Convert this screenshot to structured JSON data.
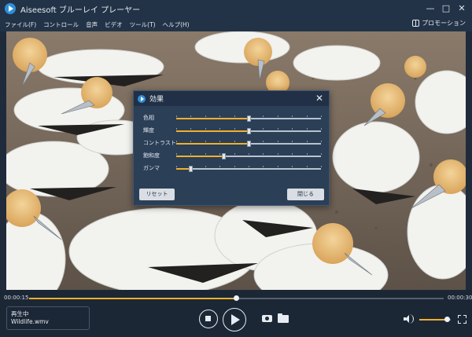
{
  "app": {
    "title": "Aiseesoft ブルーレイ プレーヤー"
  },
  "window_controls": {
    "minimize": "—",
    "maximize": "□",
    "close": "✕"
  },
  "menu": {
    "items": [
      "ファイル(F)",
      "コントロール",
      "音声",
      "ビデオ",
      "ツール(T)",
      "ヘルプ(H)"
    ]
  },
  "promo": {
    "label": "プロモーション"
  },
  "effects_dialog": {
    "title": "効果",
    "close_icon": "✕",
    "sliders": [
      {
        "label": "色相",
        "value": 0.5
      },
      {
        "label": "輝度",
        "value": 0.5
      },
      {
        "label": "コントラスト",
        "value": 0.5
      },
      {
        "label": "飽和度",
        "value": 0.33
      },
      {
        "label": "ガンマ",
        "value": 0.1
      }
    ],
    "reset_label": "リセット",
    "close_label": "閉じる"
  },
  "playback": {
    "current_time": "00:00:15",
    "total_time": "00:00:30",
    "progress": 0.5
  },
  "status": {
    "state": "再生中",
    "filename": "Wildlife.wmv"
  },
  "volume": {
    "level": 0.88
  },
  "colors": {
    "accent": "#f2b02c",
    "background": "#1f2b3b",
    "dialog": "#2b3f57"
  },
  "icons": [
    "app-logo-icon",
    "promo-gift-icon",
    "stop-icon",
    "play-icon",
    "camera-icon",
    "folder-icon",
    "volume-icon",
    "fullscreen-icon"
  ]
}
